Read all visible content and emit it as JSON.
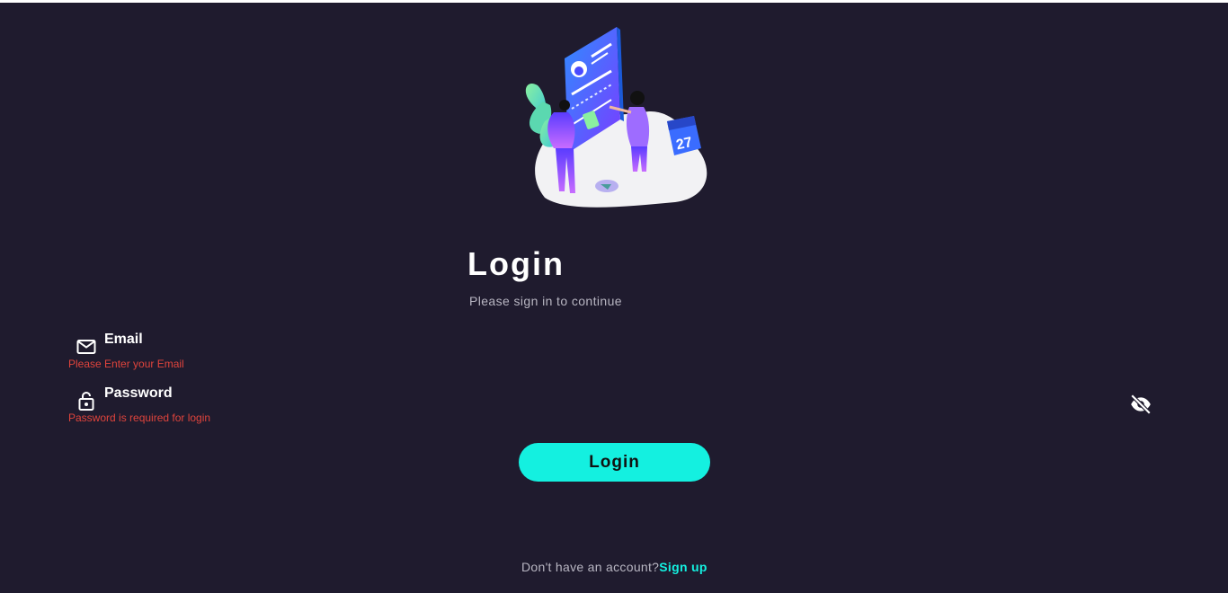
{
  "login": {
    "title": "Login",
    "subtitle": "Please sign in to continue",
    "email": {
      "label": "Email",
      "placeholder": "Email",
      "error": "Please Enter your Email",
      "icon": "mail-icon"
    },
    "password": {
      "label": "Password",
      "placeholder": "Password",
      "error": "Password is required for login",
      "icon": "lock-icon",
      "toggle_icon": "eye-off-icon"
    },
    "submit_label": "Login",
    "footer_text": "Don't have an account?",
    "signup_label": "Sign up",
    "calendar_day": "27"
  },
  "colors": {
    "background": "#1f1b2e",
    "accent": "#14f0e0",
    "error": "#e0443c",
    "muted_text": "#b8b6c2"
  }
}
